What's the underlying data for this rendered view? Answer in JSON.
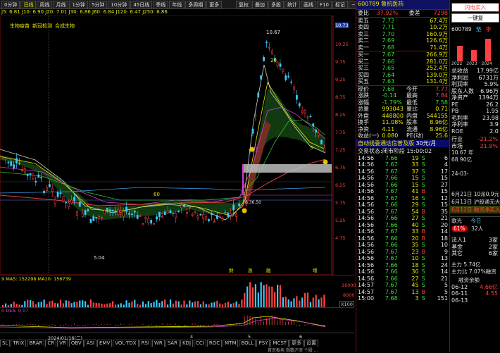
{
  "top_tabs": [
    "0分钟",
    "日线",
    "周线",
    "月线",
    "1分钟",
    "5分钟",
    "10分钟",
    "45日线",
    "季线",
    "年线",
    "多周期",
    "更多"
  ],
  "toolbar": [
    "复权",
    "叠加",
    "多股",
    "统计",
    "画线",
    "F10",
    "标记",
    "−",
    "⋮"
  ],
  "ma_line": "J5: 6.81  J10: 6.90  J20: 7.01  J30: 6.86  J60: 6.84  J120: 6.47  J250: 6.86",
  "chart_tags": [
    "生物疫苗",
    "新冠检测",
    "合成生物"
  ],
  "price_axis": [
    "10.73",
    "10.25",
    "9.75",
    "9.25",
    "8.75",
    "8.25",
    "7.75",
    "7.25",
    "6.75",
    "6.25",
    "5.75",
    "5.25",
    "4.75"
  ],
  "chart_labels": {
    "high": "10.67",
    "low": "5.04",
    "l20": "20",
    "l60": "60",
    "peak_label": "6.36.50",
    "mark_label": "5",
    "marks": [
      "財",
      "涨",
      "融",
      "增"
    ]
  },
  "vol_legend": "9 MA5: 152298 MA10: 156739",
  "vol_axis": [
    "16000",
    "8000",
    "X100"
  ],
  "macd_legend": "0  DEA: 0.07",
  "date_axis": [
    "2024/01/16(二)",
    "4",
    "5",
    "6"
  ],
  "bottom_tabs": [
    "SL",
    "TRIX",
    "BRAR",
    "CR",
    "VR",
    "OBV",
    "ASI",
    "EMV",
    "VOL-TDX",
    "RSI",
    "WR",
    "SAR",
    "KDJ",
    "CCI",
    "ROC",
    "MTM",
    "BOLL",
    "PSY",
    "MCST",
    "更多",
    "设置"
  ],
  "status_bar": "首页板块 指数沪深 个股 ...",
  "quote": {
    "code": "600789",
    "name": "鲁抗医药",
    "weibi": "37.92%",
    "weicha": "7298",
    "asks": [
      [
        "卖五",
        "7.72",
        "67.4万"
      ],
      [
        "卖四",
        "7.71",
        "10.2万"
      ],
      [
        "卖三",
        "7.70",
        "160.9万"
      ],
      [
        "卖二",
        "7.69",
        "126.6万"
      ],
      [
        "卖一",
        "7.68",
        "71.4万"
      ]
    ],
    "bids": [
      [
        "买一",
        "7.67",
        "266.9万"
      ],
      [
        "买二",
        "7.66",
        "281.0万"
      ],
      [
        "买三",
        "7.65",
        "252.4万"
      ],
      [
        "买四",
        "7.64",
        "139.0万"
      ],
      [
        "买五",
        "7.63",
        "131.4万"
      ]
    ],
    "stats": [
      [
        "现价",
        "7.68",
        "今开",
        "7.77"
      ],
      [
        "涨跌",
        "-0.14",
        "最高",
        "7.84"
      ],
      [
        "涨幅",
        "-1.79%",
        "最低",
        "7.58"
      ],
      [
        "总量",
        "993043",
        "量比",
        "0.71"
      ],
      [
        "外盘",
        "448800",
        "内盘",
        "544155"
      ],
      [
        "换手",
        "11.08%",
        "股本",
        "8.96亿"
      ],
      [
        "净资",
        "4.11",
        "流通",
        "8.96亿"
      ],
      [
        "收益(一)",
        "0.080",
        "PE(动)",
        "25.6"
      ]
    ],
    "promo": "自动线委通达信普及版",
    "promo2": "30元/月",
    "trade_state": "交易状态:闭市阶段 15:00:02",
    "ticks": [
      [
        "14:56",
        "7.66",
        "19",
        "S",
        "6"
      ],
      [
        "14:56",
        "7.67",
        "33",
        "S",
        "4"
      ],
      [
        "14:56",
        "7.67",
        "37",
        "S",
        "17"
      ],
      [
        "14:56",
        "7.66",
        "15",
        "S",
        "15"
      ],
      [
        "14:56",
        "7.66",
        "15",
        "S",
        "27"
      ],
      [
        "14:56",
        "7.67",
        "41",
        "B",
        "15"
      ],
      [
        "14:56",
        "7.67",
        "16",
        "S",
        "12"
      ],
      [
        "14:56",
        "7.66",
        "29",
        "S",
        "15"
      ],
      [
        "14:56",
        "7.67",
        "54",
        "B",
        "35"
      ],
      [
        "14:56",
        "7.66",
        "27",
        "S",
        "21"
      ],
      [
        "14:56",
        "7.66",
        "40",
        "S",
        "20"
      ],
      [
        "14:56",
        "7.67",
        "33",
        "B",
        "14"
      ],
      [
        "14:56",
        "7.66",
        "20",
        "B",
        "18"
      ],
      [
        "14:56",
        "7.66",
        "35",
        "S",
        "10"
      ],
      [
        "14:56",
        "7.67",
        "23",
        "B",
        "9"
      ],
      [
        "14:56",
        "7.67",
        "10",
        "S",
        "13"
      ],
      [
        "14:56",
        "7.66",
        "18",
        "S",
        "24"
      ],
      [
        "14:56",
        "7.66",
        "30",
        "S",
        "14"
      ],
      [
        "14:56",
        "7.66",
        "27",
        "S",
        "21"
      ],
      [
        "14:57",
        "7.67",
        "45",
        "S",
        "5"
      ],
      [
        "14:57",
        "7.67",
        "13",
        "B",
        "5"
      ],
      [
        "15:00",
        "7.68",
        "3",
        "S",
        "151"
      ]
    ],
    "units": "万"
  },
  "right_panel": {
    "buttons": [
      "闪电买入",
      "一键复"
    ],
    "code": "600789",
    "tabs": [
      "垫",
      "李"
    ],
    "years": [
      "2022",
      "2023",
      "2024"
    ],
    "fund": [
      [
        "总收益",
        "17.99亿"
      ],
      [
        "净利润",
        "6731万"
      ],
      [
        "利润率",
        "5.9%"
      ],
      [
        "股东人数",
        "6.96万"
      ],
      [
        "净资产",
        "1394万"
      ],
      [
        "PE",
        "26.2"
      ],
      [
        "PB",
        "1.95"
      ],
      [
        "毛利率",
        "23.98"
      ],
      [
        "净利率",
        "3.9"
      ],
      [
        "ROE",
        "2.0"
      ]
    ],
    "rank": [
      [
        "行业",
        "-21.2%"
      ],
      [
        "市场",
        "21.9%"
      ]
    ],
    "mkt": "10.67 年",
    "ratio": "68.90亿",
    "date": "24-03-",
    "news": [
      "6月21日 10派0.9元",
      "6月13日 沪股通无大",
      "6月12日 融资净买入"
    ],
    "jiguang": "歌光",
    "jg_tag": "今日",
    "pct": "61%",
    "people": "32人",
    "legal": [
      [
        "法人1",
        "3家"
      ],
      [
        "基金",
        "2家"
      ],
      [
        "其它",
        "6家"
      ]
    ],
    "capital": "主力 5.74亿",
    "capital2": "主力比 7.07%融资",
    "fin_head": "融资余额",
    "fin": [
      [
        "06-12",
        "4.66亿"
      ],
      [
        "06-11",
        "4.55"
      ],
      [
        "06-13",
        ""
      ]
    ]
  }
}
